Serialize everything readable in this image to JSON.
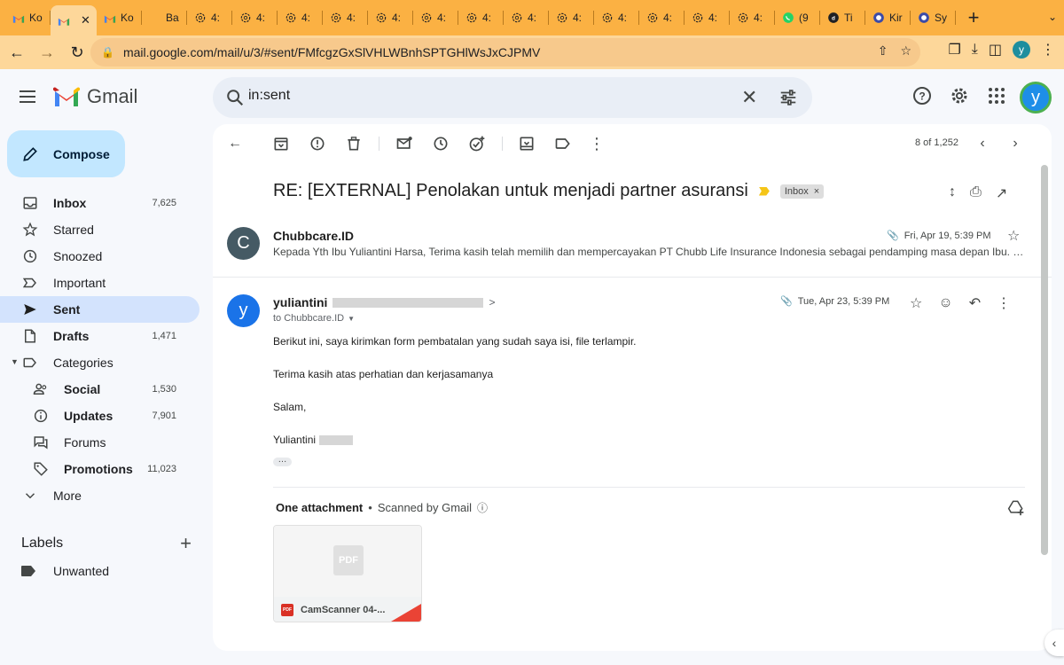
{
  "browser": {
    "tabs": [
      {
        "label": "Ko",
        "favicon": "gmail-icon"
      },
      {
        "label": "",
        "favicon": "gmail-icon",
        "active": true
      },
      {
        "label": "Ko",
        "favicon": "gmail-icon"
      },
      {
        "label": "Ba",
        "favicon": "blank-icon"
      },
      {
        "label": "4:",
        "favicon": "openai-icon"
      },
      {
        "label": "4:",
        "favicon": "openai-icon"
      },
      {
        "label": "4:",
        "favicon": "openai-icon"
      },
      {
        "label": "4:",
        "favicon": "openai-icon"
      },
      {
        "label": "4:",
        "favicon": "openai-icon"
      },
      {
        "label": "4:",
        "favicon": "openai-icon"
      },
      {
        "label": "4:",
        "favicon": "openai-icon"
      },
      {
        "label": "4:",
        "favicon": "openai-icon"
      },
      {
        "label": "4:",
        "favicon": "openai-icon"
      },
      {
        "label": "4:",
        "favicon": "openai-icon"
      },
      {
        "label": "4:",
        "favicon": "openai-icon"
      },
      {
        "label": "4:",
        "favicon": "openai-icon"
      },
      {
        "label": "4:",
        "favicon": "openai-icon"
      },
      {
        "label": "(9",
        "favicon": "whatsapp-icon"
      },
      {
        "label": "Ti",
        "favicon": "tiktok-icon"
      },
      {
        "label": "Kir",
        "favicon": "chat-icon"
      },
      {
        "label": "Sy",
        "favicon": "chat-icon"
      }
    ],
    "url": "mail.google.com/mail/u/3/#sent/FMfcgzGxSlVHLWBnhSPTGHlWsJxCJPMV",
    "avatar_letter": "y",
    "tab_colors": {
      "bar": "#fbb143",
      "active": "#fdd79a"
    }
  },
  "gmail": {
    "logo_text": "Gmail",
    "search_value": "in:sent",
    "account_letter": "y",
    "compose_label": "Compose"
  },
  "nav": [
    {
      "label": "Inbox",
      "count": "7,625",
      "icon": "inbox-icon",
      "bold": true
    },
    {
      "label": "Starred",
      "count": "",
      "icon": "star-icon"
    },
    {
      "label": "Snoozed",
      "count": "",
      "icon": "clock-icon"
    },
    {
      "label": "Important",
      "count": "",
      "icon": "important-icon"
    },
    {
      "label": "Sent",
      "count": "",
      "icon": "send-icon",
      "bold": true,
      "selected": true
    },
    {
      "label": "Drafts",
      "count": "1,471",
      "icon": "draft-icon",
      "bold": true
    },
    {
      "label": "Categories",
      "count": "",
      "icon": "label-icon",
      "caret": true
    },
    {
      "label": "Social",
      "count": "1,530",
      "icon": "people-icon",
      "bold": true,
      "sub": true
    },
    {
      "label": "Updates",
      "count": "7,901",
      "icon": "info-icon",
      "bold": true,
      "sub": true
    },
    {
      "label": "Forums",
      "count": "",
      "icon": "forum-icon",
      "sub": true
    },
    {
      "label": "Promotions",
      "count": "11,023",
      "icon": "tag-icon",
      "bold": true,
      "sub": true
    },
    {
      "label": "More",
      "count": "",
      "icon": "chevron-down-icon"
    }
  ],
  "labels": {
    "title": "Labels",
    "items": [
      {
        "label": "Unwanted",
        "icon": "label-filled-icon"
      }
    ]
  },
  "thread": {
    "pager": "8 of 1,252",
    "subject": "RE: [EXTERNAL] Penolakan untuk menjadi partner asuransi",
    "chip": "Inbox",
    "messages": [
      {
        "sender": "Chubbcare.ID",
        "avatar": "C",
        "date": "Fri, Apr 19, 5:39 PM",
        "snippet": "Kepada Yth Ibu Yuliantini Harsa, Terima kasih telah memilih dan mempercayakan PT Chubb Life Insurance Indonesia sebagai pendamping masa depan Ibu. Ka"
      },
      {
        "sender": "yuliantini",
        "avatar": "y",
        "to": "to Chubbcare.ID",
        "date": "Tue, Apr 23, 5:39 PM",
        "body": [
          "Berikut ini, saya kirimkan form pembatalan yang sudah saya isi, file terlampir.",
          "Terima kasih atas perhatian dan kerjasamanya",
          "Salam,",
          "Yuliantini"
        ]
      }
    ],
    "attachment": {
      "heading": "One attachment",
      "scanned": "Scanned by Gmail",
      "file_name": "CamScanner 04-...",
      "thumb_label": "PDF",
      "mini_label": "PDF"
    }
  }
}
